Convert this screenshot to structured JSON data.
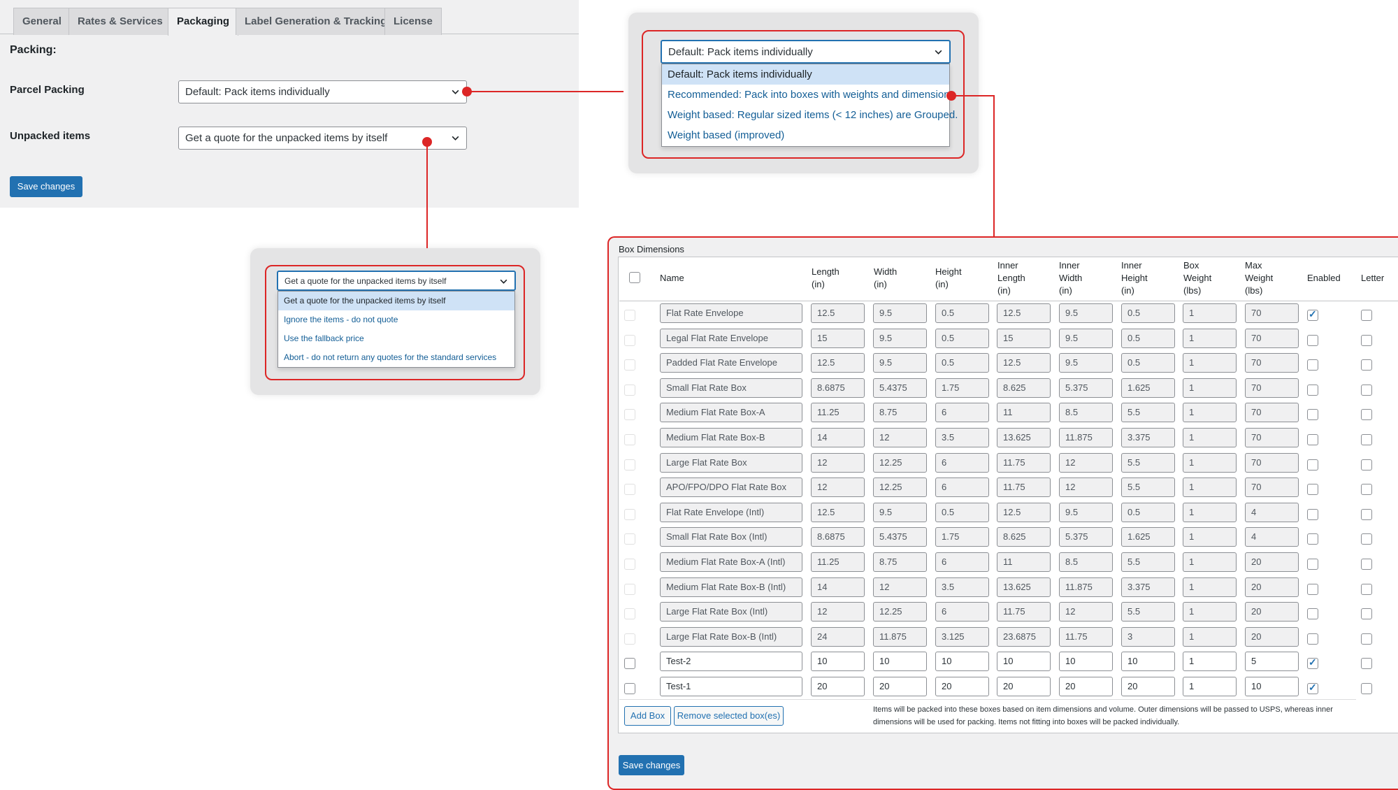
{
  "tabs": [
    {
      "label": "General",
      "active": false
    },
    {
      "label": "Rates & Services",
      "active": false
    },
    {
      "label": "Packaging",
      "active": true
    },
    {
      "label": "Label Generation & Tracking",
      "active": false
    },
    {
      "label": "License",
      "active": false
    }
  ],
  "settings": {
    "section_title": "Packing:",
    "parcel_packing": {
      "label": "Parcel Packing",
      "value": "Default: Pack items individually"
    },
    "unpacked_items": {
      "label": "Unpacked items",
      "value": "Get a quote for the unpacked items by itself"
    },
    "save_label": "Save changes"
  },
  "parcel_dropdown": {
    "selected": "Default: Pack items individually",
    "options": [
      "Default: Pack items individually",
      "Recommended: Pack into boxes with weights and dimensions",
      "Weight based: Regular sized items (< 12 inches) are Grouped.",
      "Weight based (improved)"
    ]
  },
  "unpacked_dropdown": {
    "selected": "Get a quote for the unpacked items by itself",
    "options": [
      "Get a quote for the unpacked items by itself",
      "Ignore the items - do not quote",
      "Use the fallback price",
      "Abort - do not return any quotes for the standard services"
    ]
  },
  "box_dimensions": {
    "title": "Box Dimensions",
    "columns": {
      "name": "Name",
      "length": [
        "Length",
        "(in)"
      ],
      "width": [
        "Width",
        "(in)"
      ],
      "height": [
        "Height",
        "(in)"
      ],
      "inner_length": [
        "Inner",
        "Length",
        "(in)"
      ],
      "inner_width": [
        "Inner",
        "Width",
        "(in)"
      ],
      "inner_height": [
        "Inner",
        "Height",
        "(in)"
      ],
      "box_weight": [
        "Box",
        "Weight",
        "(lbs)"
      ],
      "max_weight": [
        "Max",
        "Weight",
        "(lbs)"
      ],
      "enabled": "Enabled",
      "letter": "Letter"
    },
    "rows": [
      {
        "name": "Flat Rate Envelope",
        "l": "12.5",
        "w": "9.5",
        "h": "0.5",
        "il": "12.5",
        "iw": "9.5",
        "ih": "0.5",
        "bw": "1",
        "mw": "70",
        "enabled": true,
        "letter": false,
        "custom": false
      },
      {
        "name": "Legal Flat Rate Envelope",
        "l": "15",
        "w": "9.5",
        "h": "0.5",
        "il": "15",
        "iw": "9.5",
        "ih": "0.5",
        "bw": "1",
        "mw": "70",
        "enabled": false,
        "letter": false,
        "custom": false
      },
      {
        "name": "Padded Flat Rate Envelope",
        "l": "12.5",
        "w": "9.5",
        "h": "0.5",
        "il": "12.5",
        "iw": "9.5",
        "ih": "0.5",
        "bw": "1",
        "mw": "70",
        "enabled": false,
        "letter": false,
        "custom": false
      },
      {
        "name": "Small Flat Rate Box",
        "l": "8.6875",
        "w": "5.4375",
        "h": "1.75",
        "il": "8.625",
        "iw": "5.375",
        "ih": "1.625",
        "bw": "1",
        "mw": "70",
        "enabled": false,
        "letter": false,
        "custom": false
      },
      {
        "name": "Medium Flat Rate Box-A",
        "l": "11.25",
        "w": "8.75",
        "h": "6",
        "il": "11",
        "iw": "8.5",
        "ih": "5.5",
        "bw": "1",
        "mw": "70",
        "enabled": false,
        "letter": false,
        "custom": false
      },
      {
        "name": "Medium Flat Rate Box-B",
        "l": "14",
        "w": "12",
        "h": "3.5",
        "il": "13.625",
        "iw": "11.875",
        "ih": "3.375",
        "bw": "1",
        "mw": "70",
        "enabled": false,
        "letter": false,
        "custom": false
      },
      {
        "name": "Large Flat Rate Box",
        "l": "12",
        "w": "12.25",
        "h": "6",
        "il": "11.75",
        "iw": "12",
        "ih": "5.5",
        "bw": "1",
        "mw": "70",
        "enabled": false,
        "letter": false,
        "custom": false
      },
      {
        "name": "APO/FPO/DPO Flat Rate Box",
        "l": "12",
        "w": "12.25",
        "h": "6",
        "il": "11.75",
        "iw": "12",
        "ih": "5.5",
        "bw": "1",
        "mw": "70",
        "enabled": false,
        "letter": false,
        "custom": false
      },
      {
        "name": "Flat Rate Envelope (Intl)",
        "l": "12.5",
        "w": "9.5",
        "h": "0.5",
        "il": "12.5",
        "iw": "9.5",
        "ih": "0.5",
        "bw": "1",
        "mw": "4",
        "enabled": false,
        "letter": false,
        "custom": false
      },
      {
        "name": "Small Flat Rate Box (Intl)",
        "l": "8.6875",
        "w": "5.4375",
        "h": "1.75",
        "il": "8.625",
        "iw": "5.375",
        "ih": "1.625",
        "bw": "1",
        "mw": "4",
        "enabled": false,
        "letter": false,
        "custom": false
      },
      {
        "name": "Medium Flat Rate Box-A (Intl)",
        "l": "11.25",
        "w": "8.75",
        "h": "6",
        "il": "11",
        "iw": "8.5",
        "ih": "5.5",
        "bw": "1",
        "mw": "20",
        "enabled": false,
        "letter": false,
        "custom": false
      },
      {
        "name": "Medium Flat Rate Box-B (Intl)",
        "l": "14",
        "w": "12",
        "h": "3.5",
        "il": "13.625",
        "iw": "11.875",
        "ih": "3.375",
        "bw": "1",
        "mw": "20",
        "enabled": false,
        "letter": false,
        "custom": false
      },
      {
        "name": "Large Flat Rate Box (Intl)",
        "l": "12",
        "w": "12.25",
        "h": "6",
        "il": "11.75",
        "iw": "12",
        "ih": "5.5",
        "bw": "1",
        "mw": "20",
        "enabled": false,
        "letter": false,
        "custom": false
      },
      {
        "name": "Large Flat Rate Box-B (Intl)",
        "l": "24",
        "w": "11.875",
        "h": "3.125",
        "il": "23.6875",
        "iw": "11.75",
        "ih": "3",
        "bw": "1",
        "mw": "20",
        "enabled": false,
        "letter": false,
        "custom": false
      },
      {
        "name": "Test-2",
        "l": "10",
        "w": "10",
        "h": "10",
        "il": "10",
        "iw": "10",
        "ih": "10",
        "bw": "1",
        "mw": "5",
        "enabled": true,
        "letter": false,
        "custom": true
      },
      {
        "name": "Test-1",
        "l": "20",
        "w": "20",
        "h": "20",
        "il": "20",
        "iw": "20",
        "ih": "20",
        "bw": "1",
        "mw": "10",
        "enabled": true,
        "letter": false,
        "custom": true
      }
    ],
    "add_box_label": "Add Box",
    "remove_label": "Remove selected box(es)",
    "help_text": "Items will be packed into these boxes based on item dimensions and volume. Outer dimensions will be passed to USPS, whereas inner dimensions will be used for packing. Items not fitting into boxes will be packed individually.",
    "save_label": "Save changes"
  },
  "colors": {
    "accent": "#2271b1",
    "callout": "#dc2626",
    "panel_bg": "#f0f0f1"
  }
}
